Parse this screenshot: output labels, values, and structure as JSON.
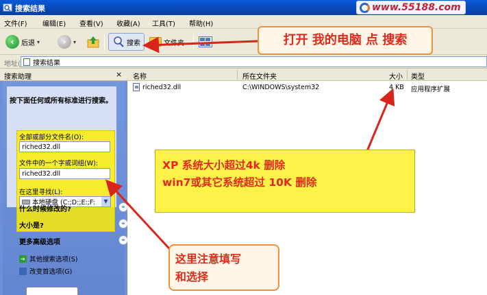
{
  "window": {
    "title": "搜索结果",
    "watermark": "www.55188.com"
  },
  "menu": [
    "文件(F)",
    "编辑(E)",
    "查看(V)",
    "收藏(A)",
    "工具(T)",
    "帮助(H)"
  ],
  "toolbar": {
    "back": "后退",
    "search": "搜索",
    "folders": "文件夹"
  },
  "address": {
    "label": "地址(D)",
    "value": "搜索结果"
  },
  "search_pane": {
    "title": "搜索助理",
    "close": "×",
    "prompt": "按下面任何或所有标准进行搜索。",
    "filename_label": "全部或部分文件名(O):",
    "filename_value": "riched32.dll",
    "phrase_label": "文件中的一个字或词组(W):",
    "phrase_value": "riched32.dll",
    "lookin_label": "在这里寻找(L):",
    "lookin_value": "本地硬盘 (C:;D:;E:;F:",
    "options": [
      "什么时候修改的?",
      "大小是?",
      "更多高级选项"
    ],
    "links": [
      "其他搜索选项(S)",
      "改变首选项(G)"
    ]
  },
  "results": {
    "columns": {
      "name": "名称",
      "folder": "所在文件夹",
      "size": "大小",
      "type": "类型"
    },
    "rows": [
      {
        "name": "riched32.dll",
        "folder": "C:\\WINDOWS\\system32",
        "size": "4 KB",
        "type": "应用程序扩展"
      }
    ]
  },
  "annotations": {
    "top": "打开 我的电脑 点 搜索",
    "yellow_line1": "XP 系统大小超过4k 删除",
    "yellow_line2": "win7或其它系统超过 10K 删除",
    "bottom_line1": "这里注意填写",
    "bottom_line2": "和选择"
  },
  "colors": {
    "annotation_text": "#e12a1b",
    "callout_border": "#ef8f3b",
    "highlight": "#fdf14a",
    "titlebar": "#0a5ad8"
  }
}
